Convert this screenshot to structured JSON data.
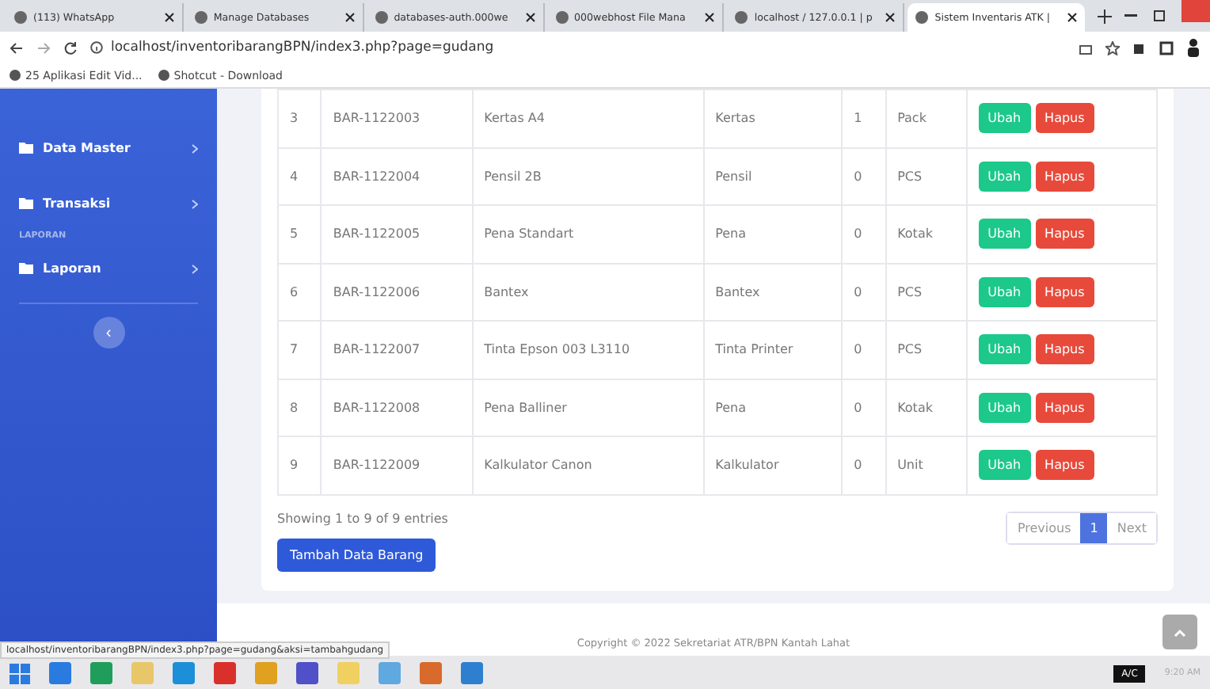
{
  "browser": {
    "tabs": [
      {
        "title": "(113) WhatsApp",
        "selected": false
      },
      {
        "title": "Manage Databases",
        "selected": false
      },
      {
        "title": "databases-auth.000we",
        "selected": false
      },
      {
        "title": "000webhost File Mana",
        "selected": false
      },
      {
        "title": "localhost / 127.0.0.1 | p",
        "selected": false
      },
      {
        "title": "Sistem Inventaris ATK |",
        "selected": true
      }
    ],
    "url": "localhost/inventoribarangBPN/index3.php?page=gudang",
    "bookmarks": [
      "25 Aplikasi Edit Vid...",
      "Shotcut - Download"
    ]
  },
  "sidebar": {
    "items": [
      {
        "label": "Data Master",
        "kind": "item"
      },
      {
        "label": "Transaksi",
        "kind": "item"
      },
      {
        "label": "LAPORAN",
        "kind": "heading"
      },
      {
        "label": "Laporan",
        "kind": "item"
      }
    ],
    "collapse": "‹"
  },
  "table": {
    "rows": [
      {
        "cells": [
          "3",
          "BAR-1122003",
          "Kertas A4",
          "Kertas",
          "1",
          "Pack"
        ],
        "edit": "Ubah",
        "delete": "Hapus"
      },
      {
        "cells": [
          "4",
          "BAR-1122004",
          "Pensil 2B",
          "Pensil",
          "0",
          "PCS"
        ],
        "edit": "Ubah",
        "delete": "Hapus"
      },
      {
        "cells": [
          "5",
          "BAR-1122005",
          "Pena Standart",
          "Pena",
          "0",
          "Kotak"
        ],
        "edit": "Ubah",
        "delete": "Hapus"
      },
      {
        "cells": [
          "6",
          "BAR-1122006",
          "Bantex",
          "Bantex",
          "0",
          "PCS"
        ],
        "edit": "Ubah",
        "delete": "Hapus"
      },
      {
        "cells": [
          "7",
          "BAR-1122007",
          "Tinta Epson 003 L3110",
          "Tinta Printer",
          "0",
          "PCS"
        ],
        "edit": "Ubah",
        "delete": "Hapus"
      },
      {
        "cells": [
          "8",
          "BAR-1122008",
          "Pena Balliner",
          "Pena",
          "0",
          "Kotak"
        ],
        "edit": "Ubah",
        "delete": "Hapus"
      },
      {
        "cells": [
          "9",
          "BAR-1122009",
          "Kalkulator Canon",
          "Kalkulator",
          "0",
          "Unit"
        ],
        "edit": "Ubah",
        "delete": "Hapus"
      }
    ]
  },
  "info": "Showing 1 to 9 of 9 entries",
  "pagination": [
    {
      "label": "Previous",
      "selected": false
    },
    {
      "label": "1",
      "selected": true
    },
    {
      "label": "Next",
      "selected": false
    }
  ],
  "add_button": "Tambah Data Barang",
  "footer": "Copyright © 2022 Sekretariat ATR/BPN Kantah Lahat",
  "status_url": "localhost/inventoribarangBPN/index3.php?page=gudang&aksi=tambahgudang",
  "taskbar": {
    "keyboard": "A/C",
    "time": "9:20 AM"
  }
}
